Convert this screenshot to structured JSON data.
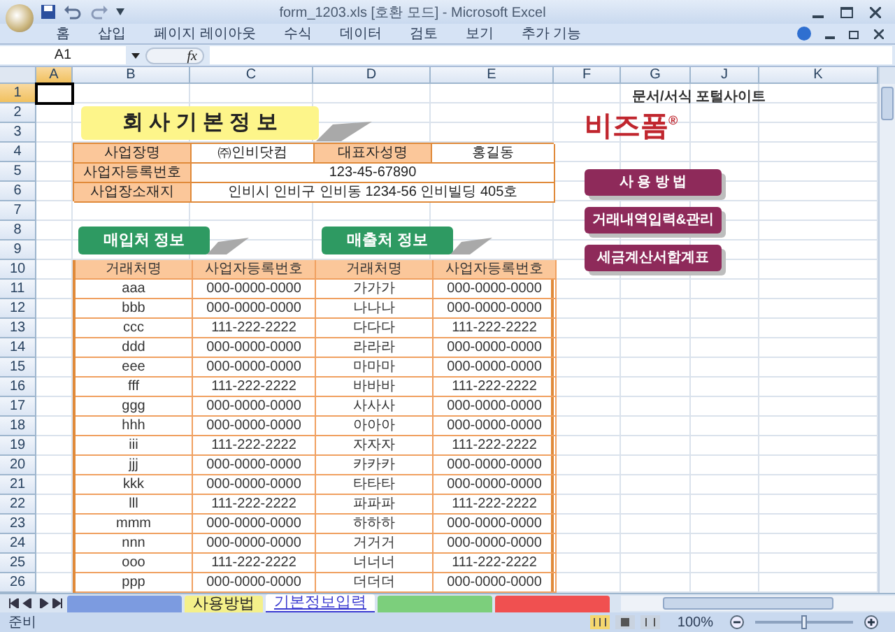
{
  "window": {
    "title": "form_1203.xls  [호환 모드] - Microsoft Excel"
  },
  "ribbon_tabs": [
    "홈",
    "삽입",
    "페이지 레이아웃",
    "수식",
    "데이터",
    "검토",
    "보기",
    "추가 기능"
  ],
  "formula_bar": {
    "name_box": "A1",
    "function_label": "fx"
  },
  "columns": [
    {
      "label": "A",
      "selected": true
    },
    {
      "label": "B",
      "selected": false
    },
    {
      "label": "C",
      "selected": false
    },
    {
      "label": "D",
      "selected": false
    },
    {
      "label": "E",
      "selected": false
    },
    {
      "label": "F",
      "selected": false
    },
    {
      "label": "G",
      "selected": false
    },
    {
      "label": "J",
      "selected": false
    },
    {
      "label": "K",
      "selected": false
    }
  ],
  "rows": [
    {
      "label": "1",
      "selected": true
    },
    {
      "label": "2",
      "selected": false
    },
    {
      "label": "3",
      "selected": false
    },
    {
      "label": "4",
      "selected": false
    },
    {
      "label": "5",
      "selected": false
    },
    {
      "label": "6",
      "selected": false
    },
    {
      "label": "7",
      "selected": false
    },
    {
      "label": "8",
      "selected": false
    },
    {
      "label": "9",
      "selected": false
    },
    {
      "label": "10",
      "selected": false
    },
    {
      "label": "11",
      "selected": false
    },
    {
      "label": "12",
      "selected": false
    },
    {
      "label": "13",
      "selected": false
    },
    {
      "label": "14",
      "selected": false
    },
    {
      "label": "15",
      "selected": false
    },
    {
      "label": "16",
      "selected": false
    },
    {
      "label": "17",
      "selected": false
    },
    {
      "label": "18",
      "selected": false
    },
    {
      "label": "19",
      "selected": false
    },
    {
      "label": "20",
      "selected": false
    },
    {
      "label": "21",
      "selected": false
    },
    {
      "label": "22",
      "selected": false
    },
    {
      "label": "23",
      "selected": false
    },
    {
      "label": "24",
      "selected": false
    },
    {
      "label": "25",
      "selected": false
    },
    {
      "label": "26",
      "selected": false
    }
  ],
  "title": "회 사 기 본 정 보",
  "company_info": [
    [
      "사업장명",
      "㈜인비닷컴",
      "대표자성명",
      "홍길동"
    ],
    [
      "사업자등록번호",
      "123-45-67890"
    ],
    [
      "사업장소재지",
      "인비시 인비구 인비동 1234-56 인비빌딩 405호"
    ]
  ],
  "sections": [
    "매입처 정보",
    "매출처 정보"
  ],
  "table": {
    "columns": [
      "거래처명",
      "사업자등록번호",
      "거래처명",
      "사업자등록번호"
    ],
    "rows": [
      [
        "aaa",
        "000-0000-0000",
        "가가가",
        "000-0000-0000"
      ],
      [
        "bbb",
        "000-0000-0000",
        "나나나",
        "000-0000-0000"
      ],
      [
        "ccc",
        "111-222-2222",
        "다다다",
        "111-222-2222"
      ],
      [
        "ddd",
        "000-0000-0000",
        "라라라",
        "000-0000-0000"
      ],
      [
        "eee",
        "000-0000-0000",
        "마마마",
        "000-0000-0000"
      ],
      [
        "fff",
        "111-222-2222",
        "바바바",
        "111-222-2222"
      ],
      [
        "ggg",
        "000-0000-0000",
        "사사사",
        "000-0000-0000"
      ],
      [
        "hhh",
        "000-0000-0000",
        "아아아",
        "000-0000-0000"
      ],
      [
        "iii",
        "111-222-2222",
        "자자자",
        "111-222-2222"
      ],
      [
        "jjj",
        "000-0000-0000",
        "카카카",
        "000-0000-0000"
      ],
      [
        "kkk",
        "000-0000-0000",
        "타타타",
        "000-0000-0000"
      ],
      [
        "lll",
        "111-222-2222",
        "파파파",
        "111-222-2222"
      ],
      [
        "mmm",
        "000-0000-0000",
        "하하하",
        "000-0000-0000"
      ],
      [
        "nnn",
        "000-0000-0000",
        "거거거",
        "000-0000-0000"
      ],
      [
        "ooo",
        "111-222-2222",
        "너너너",
        "111-222-2222"
      ],
      [
        "ppp",
        "000-0000-0000",
        "더더더",
        "000-0000-0000"
      ]
    ]
  },
  "logo": {
    "name": "비즈폼",
    "mark": "®",
    "tagline": "문서/서식 포털사이트"
  },
  "buttons": [
    "사 용 방 법",
    "거래내역입력&관리",
    "세금계산서합계표"
  ],
  "sheet_tabs": [
    {
      "color": "#7c9be0",
      "selected": false
    },
    {
      "label": "사용방법",
      "color": "#f4f08a",
      "selected": false
    },
    {
      "label": "기본정보입력",
      "color": "#3a3ad0",
      "selected": true
    },
    {
      "color": "#7ccf7c",
      "selected": false
    },
    {
      "color": "#f05050",
      "selected": false
    }
  ],
  "status_bar": {
    "text": "준비",
    "zoom": "100%",
    "zoom_slider": {
      "level": 0.5
    }
  }
}
